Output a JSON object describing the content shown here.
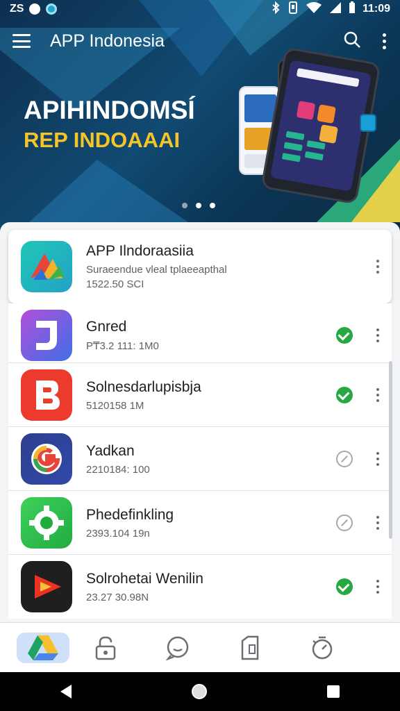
{
  "status_bar": {
    "left_text": "ZS",
    "time": "11:09"
  },
  "app_bar": {
    "title": "APP Indonesia"
  },
  "banner": {
    "line1": "APIHINDOMSÍ",
    "line2": "REP INDOAAAI",
    "pages": 3,
    "active_page": 3
  },
  "apps": [
    {
      "name": "APP Ilndoraasiia",
      "sub1": "Suraeendue vleal tplaeeapthal",
      "sub2": "1522.50 SCI",
      "status": "none",
      "icon": "multicolor-a-icon"
    },
    {
      "name": "Gnred",
      "sub1": "P₸3.2 111: 1M0",
      "sub2": "",
      "status": "installed",
      "icon": "purple-j-icon"
    },
    {
      "name": "Solnesdarlupisbja",
      "sub1": "5120158 1M",
      "sub2": "",
      "status": "installed",
      "icon": "red-b-icon"
    },
    {
      "name": "Yadkan",
      "sub1": "2210184: 100",
      "sub2": "",
      "status": "pending",
      "icon": "google-g-icon"
    },
    {
      "name": "Phedefinkling",
      "sub1": "2393.104 19n",
      "sub2": "",
      "status": "pending",
      "icon": "green-gear-icon"
    },
    {
      "name": "Solrohetai Wenilin",
      "sub1": "23.27 30.98N",
      "sub2": "",
      "status": "installed",
      "icon": "youtube-play-icon"
    }
  ],
  "bottom_nav": [
    "drive-icon",
    "lock-icon",
    "chat-icon",
    "document-icon",
    "timer-icon"
  ],
  "colors": {
    "accent_green": "#27a843",
    "banner_yellow": "#f4c428",
    "hero_bg": "#114a72"
  }
}
